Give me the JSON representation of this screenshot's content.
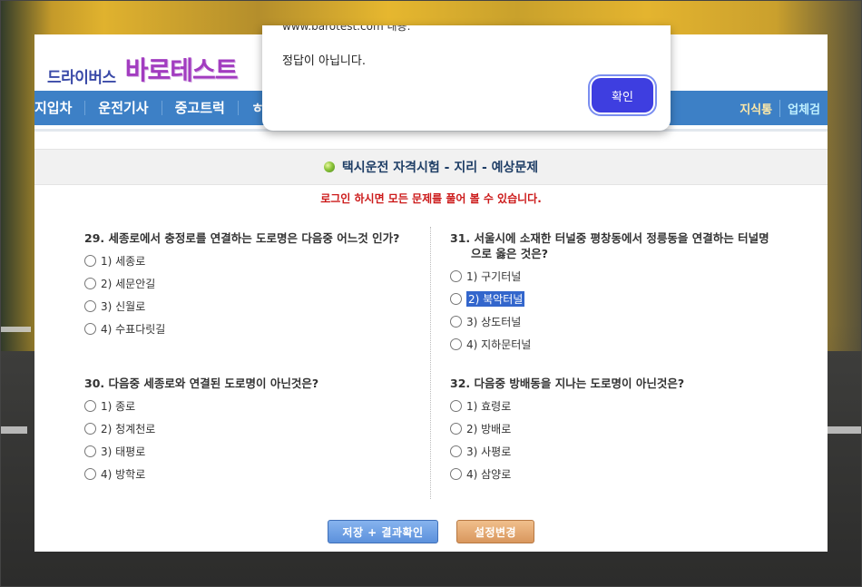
{
  "logo": {
    "small": "드라이버스",
    "big": "바로테스트"
  },
  "nav": {
    "items": [
      "지입차",
      "운전기사",
      "중고트럭",
      "ㅎ"
    ],
    "right": [
      "지식통",
      "업체검"
    ]
  },
  "title": "택시운전 자격시험 - 지리 - 예상문제",
  "login_note": "로그인 하시면 모든 문제를 풀어 볼 수 있습니다.",
  "questions": [
    {
      "title": "29. 세종로에서 충정로를 연결하는 도로명은 다음중 어느것 인가?",
      "options": [
        "1) 세종로",
        "2) 세문안길",
        "3) 신월로",
        "4) 수표다릿길"
      ]
    },
    {
      "title": "30. 다음중 세종로와 연결된 도로명이 아닌것은?",
      "options": [
        "1) 종로",
        "2) 청계천로",
        "3) 태평로",
        "4) 방학로"
      ]
    },
    {
      "title": "31. 서울시에 소재한 터널중 평창동에서 정릉동을 연결하는 터널명으로 옳은 것은?",
      "options": [
        "1) 구기터널",
        "2) 북악터널",
        "3) 상도터널",
        "4) 지하문터널"
      ]
    },
    {
      "title": "32. 다음중 방배동을 지나는 도로명이 아닌것은?",
      "options": [
        "1) 효령로",
        "2) 방배로",
        "3) 사평로",
        "4) 삼양로"
      ]
    }
  ],
  "buttons": {
    "save": "저장 + 결과확인",
    "settings": "설정변경"
  },
  "dialog": {
    "origin": "www.barotest.com 내용:",
    "message": "정답이 아닙니다.",
    "confirm": "확인"
  }
}
